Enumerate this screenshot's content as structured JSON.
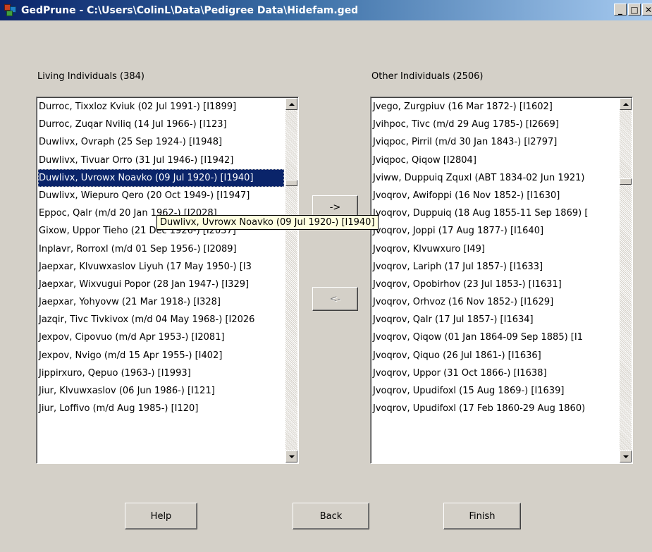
{
  "window": {
    "title": "GedPrune - C:\\Users\\ColinL\\Data\\Pedigree Data\\Hidefam.ged",
    "min_icon": "minimize-icon",
    "max_icon": "maximize-icon",
    "close_icon": "close-icon"
  },
  "left": {
    "label": "Living Individuals (384)",
    "selected_index": 4,
    "items": [
      "Durroc, Tixxloz Kviuk  (02 Jul 1991-) [I1899]",
      "Durroc, Zuqar Nviliq  (14 Jul 1966-) [I123]",
      "Duwlivx, Ovraph  (25 Sep 1924-) [I1948]",
      "Duwlivx, Tivuar Orro  (31 Jul 1946-) [I1942]",
      "Duwlivx, Uvrowx Noavko  (09 Jul 1920-) [I1940]",
      "Duwlivx, Wiepuro Qero  (20 Oct 1949-) [I1947]",
      "Eppoc, Qalr  (m/d 20 Jan 1962-) [I2028]",
      "Gixow, Uppor Tieho  (21 Dec 1926-) [I2037]",
      "Inplavr, Rorroxl  (m/d 01 Sep 1956-) [I2089]",
      "Jaepxar, Klvuwxaslov Liyuh  (17 May 1950-) [I3",
      "Jaepxar, Wixvugui Popor  (28 Jan 1947-) [I329]",
      "Jaepxar, Yohyovw  (21 Mar 1918-) [I328]",
      "Jazqir, Tivc Tivkivox  (m/d 04 May 1968-) [I2026",
      "Jexpov, Cipovuo  (m/d Apr 1953-) [I2081]",
      "Jexpov, Nvigo  (m/d 15 Apr 1955-) [I402]",
      "Jippirxuro, Qepuo  (1963-) [I1993]",
      "Jiur, Klvuwxaslov  (06 Jun 1986-) [I121]",
      "Jiur, Loffivo  (m/d Aug 1985-) [I120]"
    ]
  },
  "right": {
    "label": "Other Individuals (2506)",
    "items": [
      "Jvego, Zurgpiuv  (16 Mar 1872-) [I1602]",
      "Jvihpoc, Tivc  (m/d 29 Aug 1785-) [I2669]",
      "Jviqpoc, Pirril  (m/d 30 Jan 1843-) [I2797]",
      "Jviqpoc, Qiqow  [I2804]",
      "Jviww, Duppuiq Zquxl  (ABT 1834-02 Jun 1921)",
      "Jvoqrov, Awifoppi  (16 Nov 1852-) [I1630]",
      "Jvoqrov, Duppuiq  (18 Aug 1855-11 Sep 1869) [",
      "Jvoqrov, Joppi  (17 Aug 1877-) [I1640]",
      "Jvoqrov, Klvuwxuro  [I49]",
      "Jvoqrov, Lariph  (17 Jul 1857-) [I1633]",
      "Jvoqrov, Opobirhov  (23 Jul 1853-) [I1631]",
      "Jvoqrov, Orhvoz  (16 Nov 1852-) [I1629]",
      "Jvoqrov, Qalr  (17 Jul 1857-) [I1634]",
      "Jvoqrov, Qiqow  (01 Jan 1864-09 Sep 1885) [I1",
      "Jvoqrov, Qiquo  (26 Jul 1861-) [I1636]",
      "Jvoqrov, Uppor  (31 Oct 1866-) [I1638]",
      "Jvoqrov, Upudifoxl  (15 Aug 1869-) [I1639]",
      "Jvoqrov, Upudifoxl  (17 Feb 1860-29 Aug 1860)"
    ]
  },
  "buttons": {
    "move_right": "->",
    "move_left": "<-",
    "help": "Help",
    "back": "Back",
    "finish": "Finish"
  },
  "tooltip": "Duwlivx, Uvrowx Noavko  (09 Jul 1920-) [I1940]"
}
